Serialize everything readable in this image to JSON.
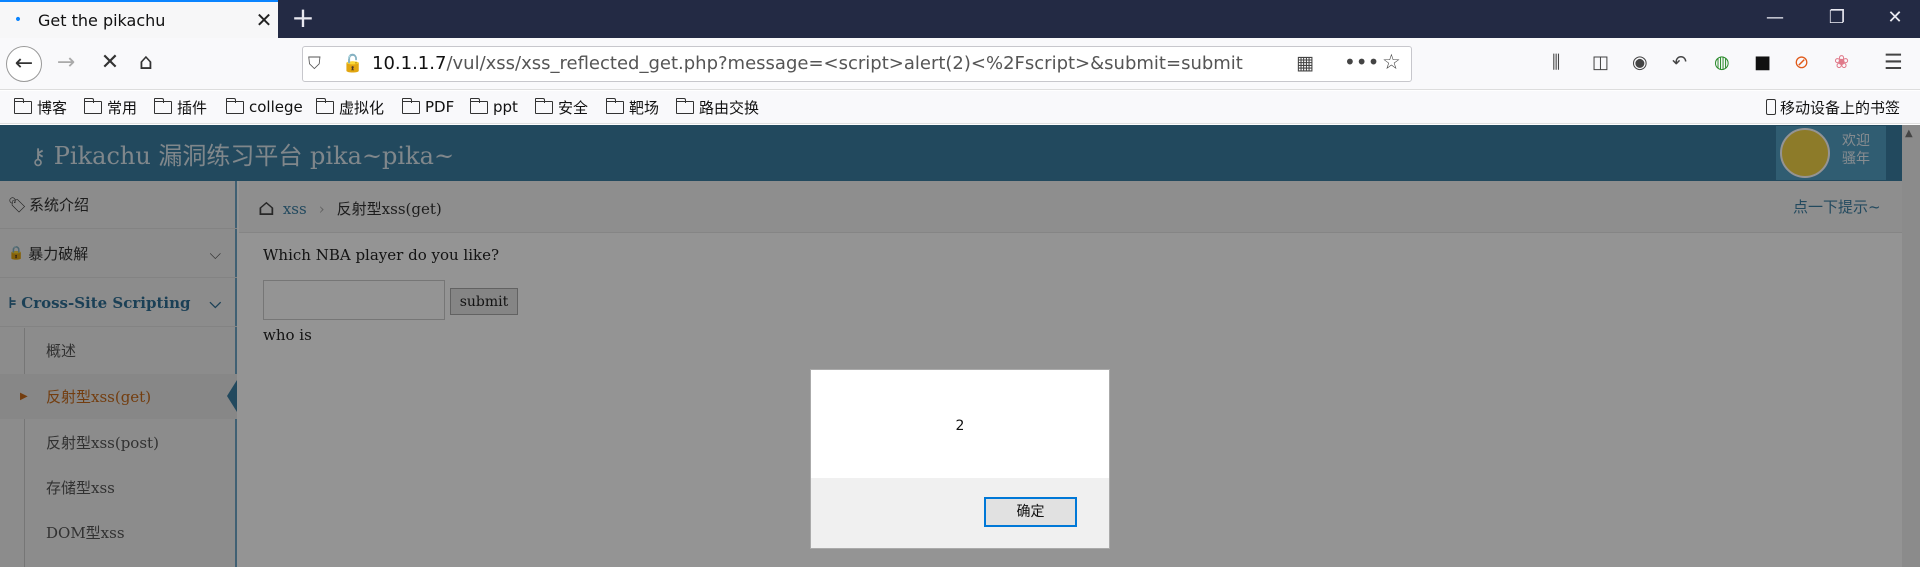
{
  "browser": {
    "tab_title": "Get the pikachu",
    "url_host": "10.1.1.7",
    "url_path": "/vul/xss/xss_reflected_get.php?message=<script>alert(2)<%2Fscript>&submit=submit",
    "bookmarks": [
      "博客",
      "常用",
      "插件",
      "college",
      "虚拟化",
      "PDF",
      "ppt",
      "安全",
      "靶场",
      "路由交换"
    ],
    "mobile_bookmarks": "移动设备上的书签"
  },
  "site": {
    "brand": "Pikachu 漏洞练习平台 pika~pika~",
    "welcome": [
      "欢迎",
      "骚年"
    ]
  },
  "sidebar": {
    "sections": [
      "系统介绍",
      "暴力破解",
      "Cross-Site Scripting"
    ],
    "sub_items": [
      "概述",
      "反射型xss(get)",
      "反射型xss(post)",
      "存储型xss",
      "DOM型xss"
    ],
    "active_sub": "反射型xss(get)"
  },
  "breadcrumb": {
    "parent": "xss",
    "current": "反射型xss(get)",
    "hint": "点一下提示~"
  },
  "form": {
    "question": "Which NBA player do you like?",
    "input_value": "",
    "submit_label": "submit",
    "result_text": "who is"
  },
  "alert": {
    "message": "2",
    "ok_label": "确定"
  },
  "colors": {
    "header": "#3b7ea3",
    "accent_link": "#3b7ea3",
    "tab_accent": "#0a84ff"
  }
}
